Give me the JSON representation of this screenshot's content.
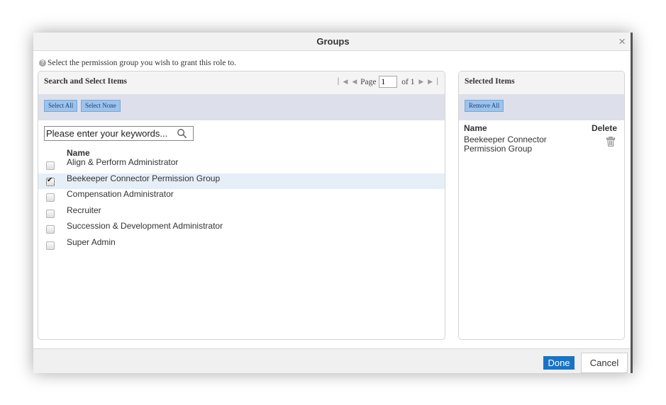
{
  "dialog": {
    "title": "Groups",
    "close_symbol": "×"
  },
  "instruction": "Select the permission group you wish to grant this role to.",
  "left_panel": {
    "title": "Search and Select Items",
    "select_all": "Select All",
    "select_none": "Select None",
    "pager": {
      "page_label": "Page",
      "page_value": "1",
      "of_label": "of 1"
    },
    "search_placeholder": "Please enter your keywords...",
    "column_name": "Name",
    "items": [
      {
        "label": "Align & Perform Administrator",
        "checked": false
      },
      {
        "label": "Beekeeper Connector Permission Group",
        "checked": true
      },
      {
        "label": "Compensation Administrator",
        "checked": false
      },
      {
        "label": "Recruiter",
        "checked": false
      },
      {
        "label": "Succession & Development Administrator",
        "checked": false
      },
      {
        "label": "Super Admin",
        "checked": false
      }
    ]
  },
  "right_panel": {
    "title": "Selected Items",
    "remove_all": "Remove All",
    "column_name": "Name",
    "column_delete": "Delete",
    "items": [
      {
        "label": "Beekeeper Connector Permission Group"
      }
    ]
  },
  "footer": {
    "done": "Done",
    "cancel": "Cancel"
  },
  "colors": {
    "accent": "#1a73c4",
    "selected_row": "#e6eff8",
    "toolbar_button": "#9cc3ec"
  }
}
